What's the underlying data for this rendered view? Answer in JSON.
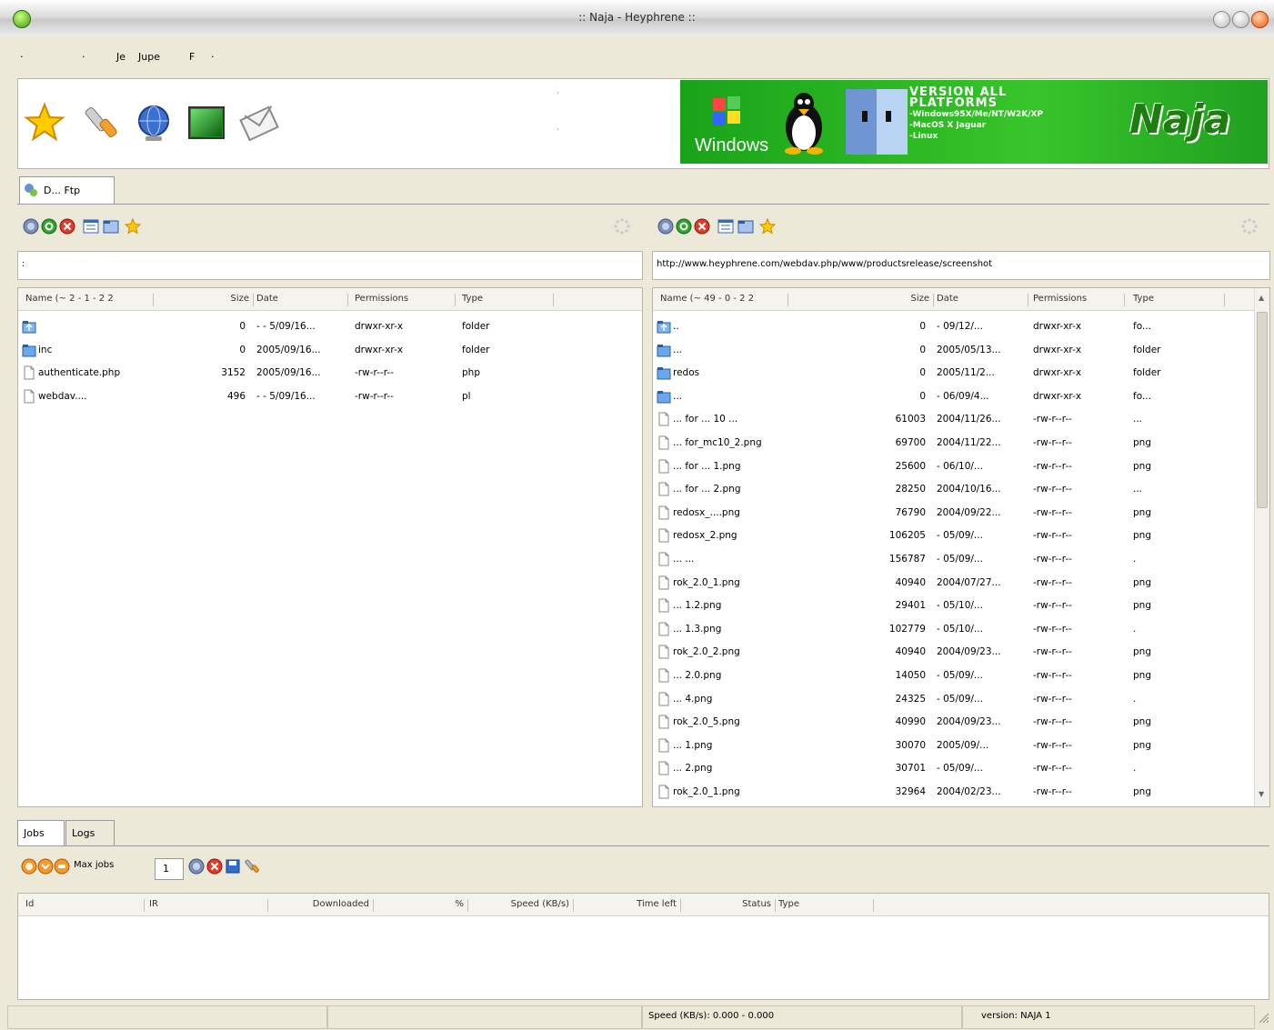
{
  "window": {
    "title": ":: Naja - Heyphrene ::"
  },
  "menu": {
    "items": [
      "·",
      "·",
      "Je",
      "Jupe",
      "F",
      "·"
    ]
  },
  "banner": {
    "line1": "VERSION ALL",
    "line2": "PLATFORMS",
    "line3": "-Windows95X/Me/NT/W2K/XP",
    "line4": "-MacOS X Jaguar",
    "line5": "-Linux",
    "windows_label": "Windows",
    "logo": "Naja"
  },
  "main_tab": {
    "label": "D... Ftp"
  },
  "left_pane": {
    "address": ":",
    "columns": [
      "Name (~ 2 - 1 - 2 2",
      "Size",
      "Date",
      "Permissions",
      "Type"
    ],
    "rows": [
      {
        "icon": "folder-up-icon",
        "name": "",
        "size": "0",
        "date": "- - 5/09/16...",
        "perm": "drwxr-xr-x",
        "type": "folder"
      },
      {
        "icon": "folder-icon",
        "name": "inc",
        "size": "0",
        "date": "2005/09/16...",
        "perm": "drwxr-xr-x",
        "type": "folder"
      },
      {
        "icon": "file-icon",
        "name": "authenticate.php",
        "size": "3152",
        "date": "2005/09/16...",
        "perm": "-rw-r--r--",
        "type": "php"
      },
      {
        "icon": "file-icon",
        "name": "webdav....",
        "size": "496",
        "date": "- - 5/09/16...",
        "perm": "-rw-r--r--",
        "type": "pl"
      }
    ]
  },
  "right_pane": {
    "address": "http://www.heyphrene.com/webdav.php/www/productsrelease/screenshot",
    "columns": [
      "Name (~ 49 - 0 - 2 2",
      "Size",
      "Date",
      "Permissions",
      "Type"
    ],
    "rows": [
      {
        "icon": "folder-up-icon",
        "name": "..",
        "size": "0",
        "date": "- 09/12/...",
        "perm": "drwxr-xr-x",
        "type": "fo..."
      },
      {
        "icon": "folder-icon",
        "name": "...",
        "size": "0",
        "date": "2005/05/13...",
        "perm": "drwxr-xr-x",
        "type": "folder"
      },
      {
        "icon": "folder-icon",
        "name": "redos",
        "size": "0",
        "date": "2005/11/2...",
        "perm": "drwxr-xr-x",
        "type": "folder"
      },
      {
        "icon": "folder-icon",
        "name": "...",
        "size": "0",
        "date": "- 06/09/4...",
        "perm": "drwxr-xr-x",
        "type": "fo..."
      },
      {
        "icon": "file-icon",
        "name": "... for ... 10 ...",
        "size": "61003",
        "date": "2004/11/26...",
        "perm": "-rw-r--r--",
        "type": "..."
      },
      {
        "icon": "file-icon",
        "name": "... for_mc10_2.png",
        "size": "69700",
        "date": "2004/11/22...",
        "perm": "-rw-r--r--",
        "type": "png"
      },
      {
        "icon": "file-icon",
        "name": "... for ... 1.png",
        "size": "25600",
        "date": "- 06/10/...",
        "perm": "-rw-r--r--",
        "type": "png"
      },
      {
        "icon": "file-icon",
        "name": "... for ... 2.png",
        "size": "28250",
        "date": "2004/10/16...",
        "perm": "-rw-r--r--",
        "type": "..."
      },
      {
        "icon": "file-icon",
        "name": "redosx_....png",
        "size": "76790",
        "date": "2004/09/22...",
        "perm": "-rw-r--r--",
        "type": "png"
      },
      {
        "icon": "file-icon",
        "name": "redosx_2.png",
        "size": "106205",
        "date": "- 05/09/...",
        "perm": "-rw-r--r--",
        "type": "png"
      },
      {
        "icon": "file-icon",
        "name": "... ...",
        "size": "156787",
        "date": "- 05/09/...",
        "perm": "-rw-r--r--",
        "type": "."
      },
      {
        "icon": "file-icon",
        "name": "rok_2.0_1.png",
        "size": "40940",
        "date": "2004/07/27...",
        "perm": "-rw-r--r--",
        "type": "png"
      },
      {
        "icon": "file-icon",
        "name": "... 1.2.png",
        "size": "29401",
        "date": "- 05/10/...",
        "perm": "-rw-r--r--",
        "type": "png"
      },
      {
        "icon": "file-icon",
        "name": "... 1.3.png",
        "size": "102779",
        "date": "- 05/10/...",
        "perm": "-rw-r--r--",
        "type": "."
      },
      {
        "icon": "file-icon",
        "name": "rok_2.0_2.png",
        "size": "40940",
        "date": "2004/09/23...",
        "perm": "-rw-r--r--",
        "type": "png"
      },
      {
        "icon": "file-icon",
        "name": "... 2.0.png",
        "size": "14050",
        "date": "- 05/09/...",
        "perm": "-rw-r--r--",
        "type": "png"
      },
      {
        "icon": "file-icon",
        "name": "... 4.png",
        "size": "24325",
        "date": "- 05/09/...",
        "perm": "-rw-r--r--",
        "type": "."
      },
      {
        "icon": "file-icon",
        "name": "rok_2.0_5.png",
        "size": "40990",
        "date": "2004/09/23...",
        "perm": "-rw-r--r--",
        "type": "png"
      },
      {
        "icon": "file-icon",
        "name": "... 1.png",
        "size": "30070",
        "date": "2005/09/...",
        "perm": "-rw-r--r--",
        "type": "png"
      },
      {
        "icon": "file-icon",
        "name": "... 2.png",
        "size": "30701",
        "date": "- 05/09/...",
        "perm": "-rw-r--r--",
        "type": "."
      },
      {
        "icon": "file-icon",
        "name": "rok_2.0_1.png",
        "size": "32964",
        "date": "2004/02/23...",
        "perm": "-rw-r--r--",
        "type": "png"
      }
    ]
  },
  "bottom": {
    "tabs": [
      "Jobs",
      "Logs"
    ],
    "threads_label": "Max jobs",
    "threads_value": "1",
    "columns": [
      "Id",
      "IR",
      "Downloaded",
      "%",
      "Speed (KB/s)",
      "Time left",
      "Status",
      "Type"
    ]
  },
  "status": {
    "speed": "Speed (KB/s): 0.000 - 0.000",
    "version": "version: NAJA 1"
  }
}
